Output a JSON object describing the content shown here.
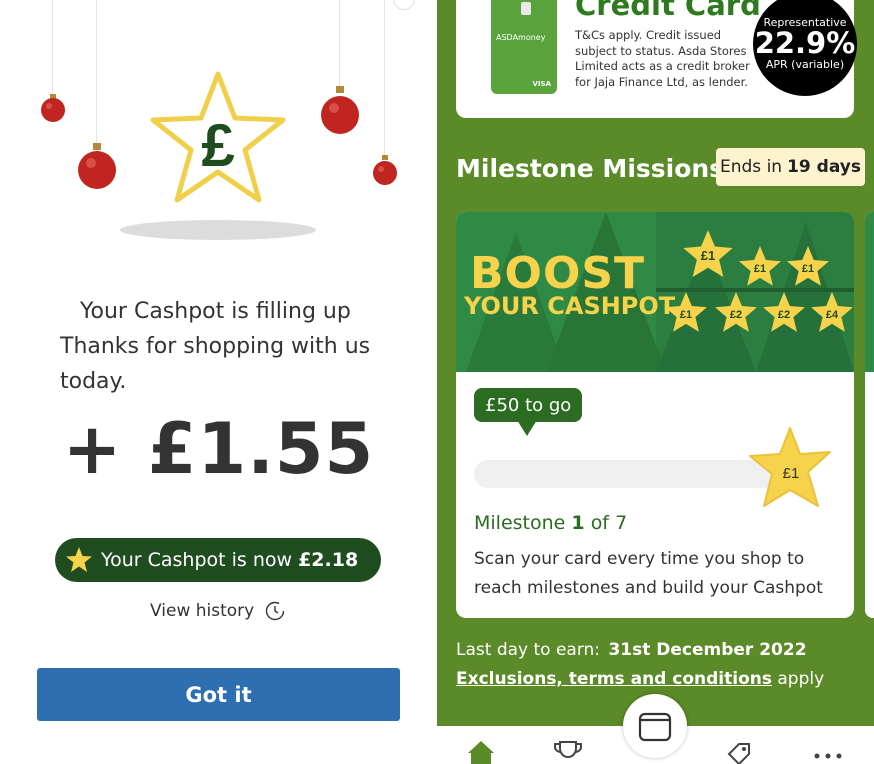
{
  "left": {
    "filling_line1": "Your Cashpot is filling up",
    "filling_line2": "Thanks for shopping with us",
    "filling_line3": "today.",
    "amount": "+ £1.55",
    "star_symbol": "£",
    "cashpot_prefix": "Your Cashpot is now",
    "cashpot_value": "£2.18",
    "view_history": "View history",
    "got_it": "Got it",
    "colors": {
      "pill": "#1f4d20",
      "button": "#2d6fb0",
      "ornament": "#c0261f",
      "star_outline": "#f0cf4a"
    }
  },
  "right": {
    "credit_card": {
      "title": "Credit Card",
      "text": "T&Cs apply. Credit issued subject to status. Asda Stores Limited acts as a credit broker for Jaja Finance Ltd, as lender.",
      "brand": "ASDA",
      "brand_suffix": "money",
      "card_network": "VISA",
      "apr_representative": "Representative",
      "apr_value": "22.9%",
      "apr_variable": "APR (variable)"
    },
    "missions": {
      "heading": "Milestone Missions",
      "ends_prefix": "Ends in",
      "ends_value": "19 days"
    },
    "banner": {
      "line1": "BOOST",
      "line2": "YOUR CASHPOT",
      "stars": [
        "£1",
        "£1",
        "£1",
        "£1",
        "£2",
        "£2",
        "£4"
      ]
    },
    "card": {
      "to_go": "£50 to go",
      "progress": 0.0,
      "reward": "£1",
      "milestone_prefix": "Milestone",
      "milestone_current": "1",
      "milestone_of": "of",
      "milestone_total": "7",
      "description": "Scan your card every time you shop to reach milestones and build your Cashpot"
    },
    "last_day_label": "Last day to earn:",
    "last_day_value": "31st December 2022",
    "terms_link": "Exclusions, terms and conditions",
    "terms_suffix": "apply",
    "nav": {
      "icons": [
        "home-icon",
        "trophy-icon",
        "wallet-icon",
        "offers-tag-icon",
        "more-icon"
      ],
      "active_color": "#5b8a28"
    },
    "colors": {
      "background": "#5b8a28",
      "banner": "#2f8a45",
      "gold": "#f6d34b",
      "dark_green": "#2c6b22"
    }
  }
}
